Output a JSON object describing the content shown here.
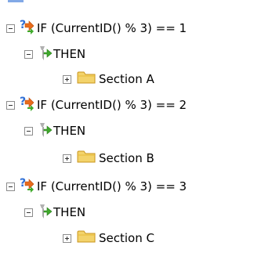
{
  "tree": {
    "nodes": [
      {
        "condition": "IF (CurrentID() % 3) == 1",
        "then_label": "THEN",
        "section_label": "Section A"
      },
      {
        "condition": "IF (CurrentID() % 3) == 2",
        "then_label": "THEN",
        "section_label": "Section B"
      },
      {
        "condition": "IF (CurrentID() % 3) == 3",
        "then_label": "THEN",
        "section_label": "Section C"
      }
    ]
  },
  "icons": {
    "condition": "question-arrow-icon",
    "then": "green-arrow-icon",
    "section": "folder-icon"
  },
  "colors": {
    "folder_fill": "#f3d36b",
    "folder_edge": "#c9941c",
    "question_blue": "#2f6fd6",
    "arrow_orange": "#e86b1c",
    "arrow_green": "#3faa2b",
    "then_gray": "#b0b0b0"
  }
}
